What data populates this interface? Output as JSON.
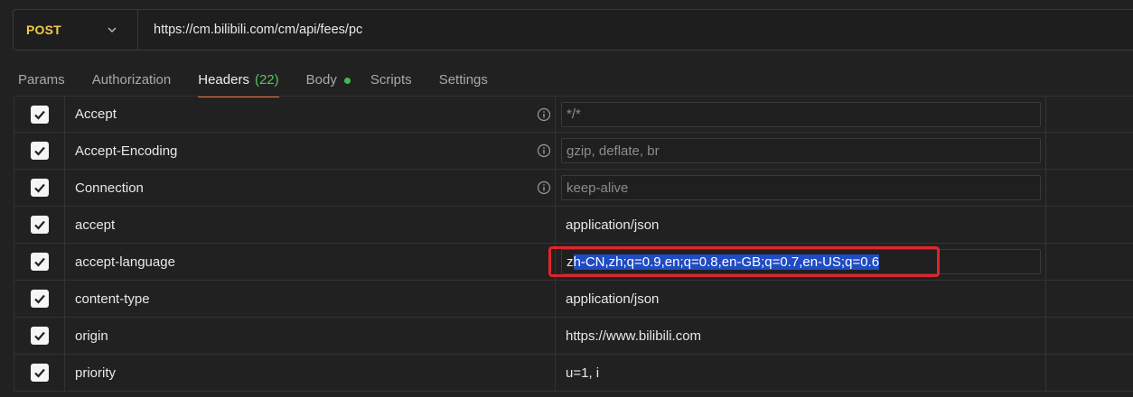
{
  "request": {
    "method": "POST",
    "url": "https://cm.bilibili.com/cm/api/fees/pc"
  },
  "tabs": [
    {
      "label": "Params"
    },
    {
      "label": "Authorization"
    },
    {
      "label": "Headers",
      "count": "(22)"
    },
    {
      "label": "Body"
    },
    {
      "label": "Scripts"
    },
    {
      "label": "Settings"
    }
  ],
  "headers": [
    {
      "key": "Accept",
      "value": "*/*"
    },
    {
      "key": "Accept-Encoding",
      "value": "gzip, deflate, br"
    },
    {
      "key": "Connection",
      "value": "keep-alive"
    },
    {
      "key": "accept",
      "value": "application/json"
    },
    {
      "key": "accept-language",
      "value_first": "z",
      "value_selected": "h-CN,zh;q=0.9,en;q=0.8,en-GB;q=0.7,en-US;q=0.6"
    },
    {
      "key": "content-type",
      "value": "application/json"
    },
    {
      "key": "origin",
      "value": "https://www.bilibili.com"
    },
    {
      "key": "priority",
      "value": "u=1, i"
    }
  ],
  "colors": {
    "method": "#f2c94c",
    "active_tab_underline": "#ff6c37",
    "count": "#5fbf6a",
    "body_dot": "#3fb950",
    "selection": "#1f4cc4",
    "highlight_box": "#e0242a"
  }
}
